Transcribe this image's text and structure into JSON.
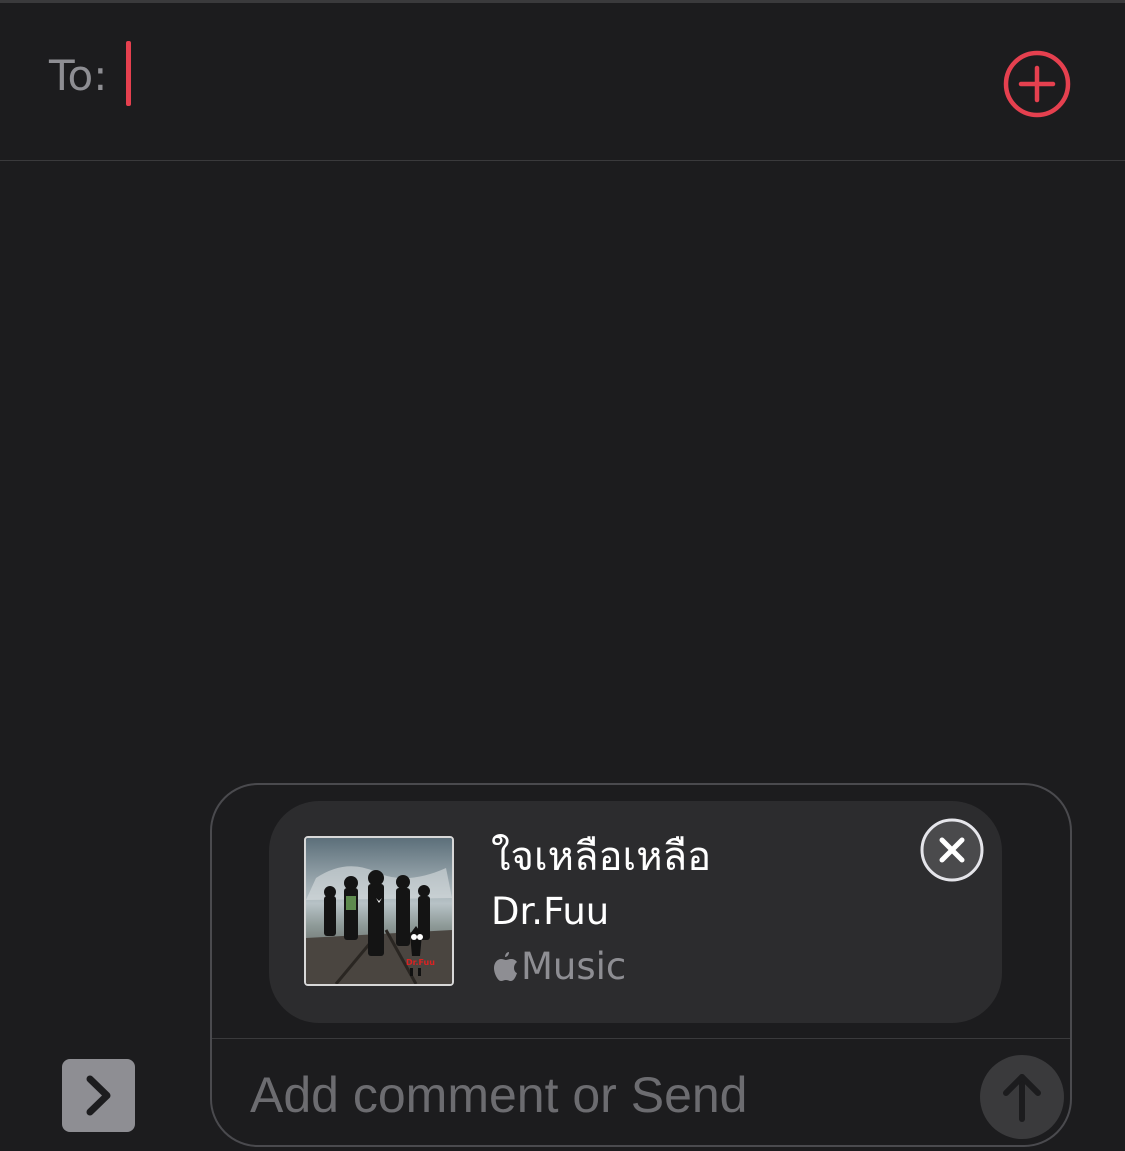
{
  "header": {
    "to_label": "To:"
  },
  "recipient": {
    "value": ""
  },
  "attachment": {
    "song_title": "ใจเหลือเหลือ",
    "artist": "Dr.Fuu",
    "source_label": "Music",
    "album_logo_text": "Dr.Fuu"
  },
  "composer": {
    "placeholder": "Add comment or Send",
    "value": ""
  },
  "icons": {
    "add_contact": "plus-circle-icon",
    "remove_attachment": "close-circle-icon",
    "send": "arrow-up-icon",
    "expand": "chevron-right-icon",
    "source": "apple-logo-icon"
  },
  "colors": {
    "accent": "#e5404f",
    "background": "#1c1c1e",
    "card": "#2c2c2e",
    "secondary_text": "#8e8e93"
  }
}
